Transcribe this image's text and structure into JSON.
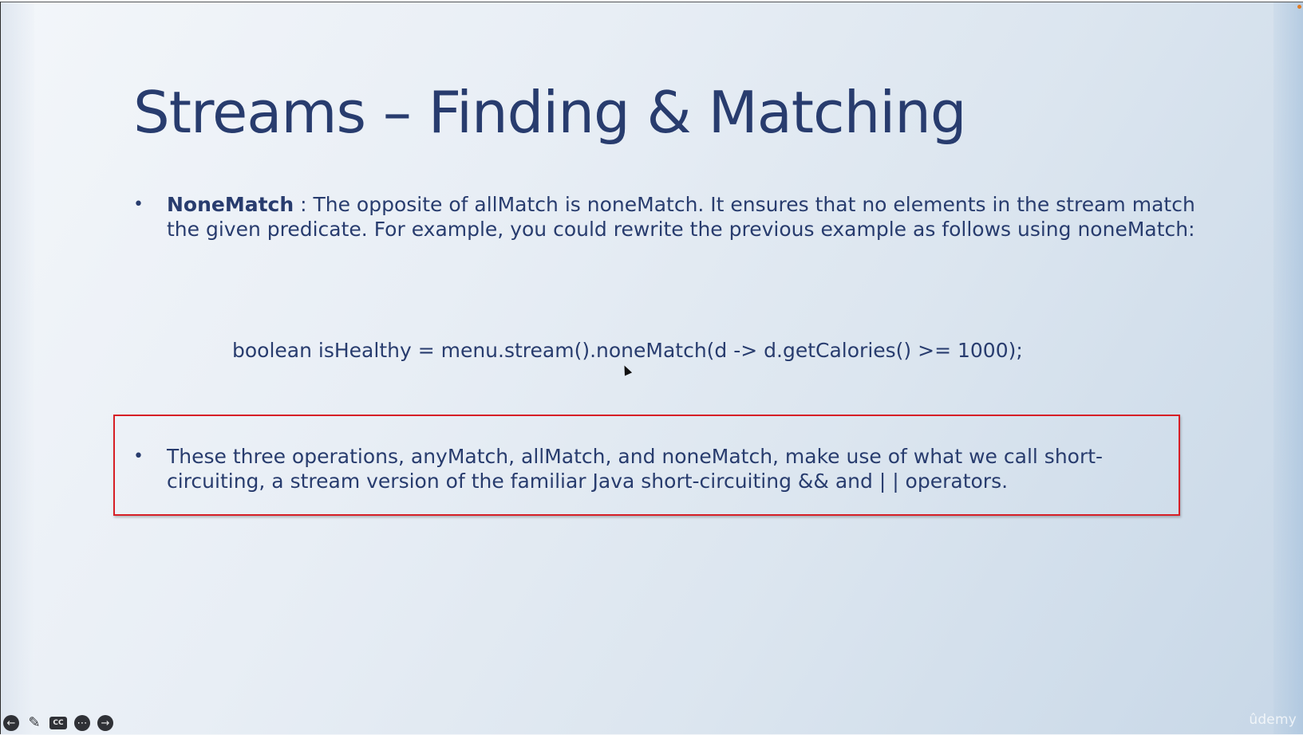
{
  "slide": {
    "title": "Streams – Finding & Matching",
    "bullet1": {
      "marker": "•",
      "term": "NoneMatch",
      "text": " : The opposite of allMatch is noneMatch. It ensures that no elements in the stream match the given predicate. For example, you could rewrite the previous example as follows using noneMatch:"
    },
    "code": "boolean isHealthy = menu.stream().noneMatch(d -> d.getCalories() >= 1000);",
    "bullet2": {
      "marker": "•",
      "text": "These three operations, anyMatch, allMatch, and noneMatch, make use of what we call short-circuiting, a stream version of the familiar Java short-circuiting && and | | operators."
    },
    "highlight_color": "#d71f26",
    "text_color": "#283c6e"
  },
  "controls": {
    "back_icon": "arrow-left",
    "pen_icon": "pencil",
    "captions_label": "CC",
    "more_icon": "ellipsis",
    "forward_icon": "arrow-right"
  },
  "brand": {
    "label": "ûdemy"
  }
}
